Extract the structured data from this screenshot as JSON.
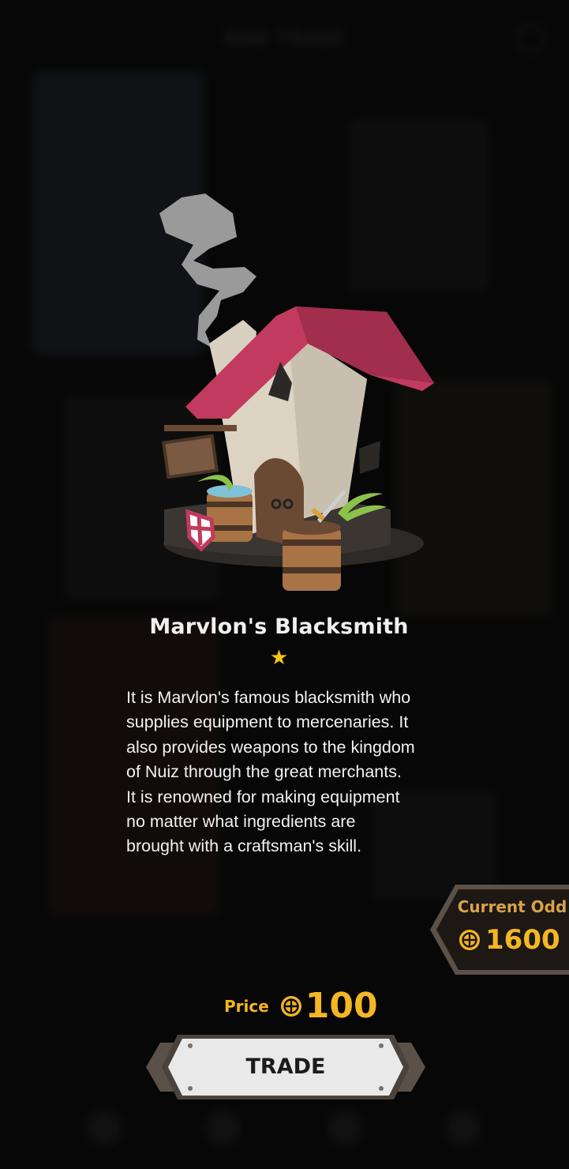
{
  "background": {
    "title": "BNB TRADE"
  },
  "building": {
    "name": "Marvlon's Blacksmith",
    "star_icon": "★",
    "stars": 1,
    "description": "It is Marvlon's famous blacksmith who\nsupplies equipment to mercenaries. It\nalso provides weapons to the kingdom\nof Nuiz through the great merchants.\nIt is renowned for making equipment\nno matter what ingredients are\nbrought with a craftsman's skill."
  },
  "current_odd": {
    "label": "Current Odd",
    "value": "1600",
    "icon": "coin-icon"
  },
  "price": {
    "label": "Price",
    "value": "100",
    "icon": "coin-icon"
  },
  "trade_button": {
    "label": "TRADE"
  },
  "colors": {
    "gold": "#f4b624",
    "odd_label": "#d9a24a",
    "panel_bg": "#1d1814",
    "panel_border": "#5b5148",
    "roof": "#c23a5d",
    "button_bg": "#e9e9e9"
  }
}
